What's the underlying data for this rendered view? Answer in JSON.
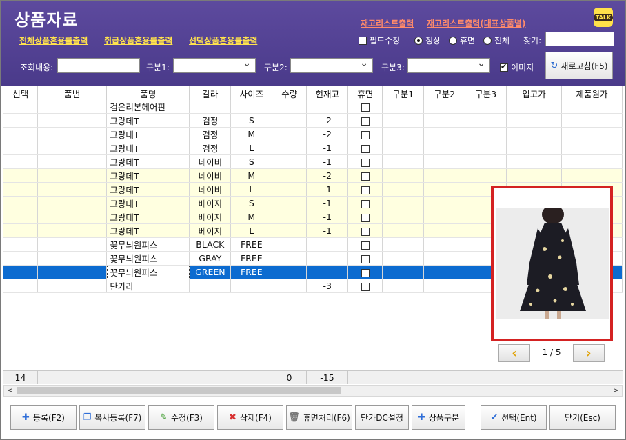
{
  "header": {
    "title": "상품자료",
    "links_top": [
      "재고리스트출력",
      "재고리스트출력(대표상품별)"
    ],
    "links_bottom": [
      "전체상품혼용률출력",
      "취급상품혼용률출력",
      "선택상품혼용률출력"
    ],
    "talk_label": "TALK",
    "field_edit_label": "필드수정",
    "radio_normal": "정상",
    "radio_dormant": "휴면",
    "radio_all": "전체",
    "find_label": "찾기:",
    "find_value": ""
  },
  "filters": {
    "query_label": "조회내용:",
    "cat1_label": "구분1:",
    "cat2_label": "구분2:",
    "cat3_label": "구분3:",
    "image_label": "이미지",
    "refresh_label": "새로고침(F5)"
  },
  "table": {
    "columns": [
      "선택",
      "품번",
      "품명",
      "칼라",
      "사이즈",
      "수량",
      "현재고",
      "휴면",
      "구분1",
      "구분2",
      "구분3",
      "입고가",
      "제품원가"
    ],
    "rows": [
      {
        "name": "검은리본헤어핀",
        "color": "",
        "size": "",
        "qty": "",
        "stock": "",
        "style": "normal"
      },
      {
        "name": "그랑데T",
        "color": "검정",
        "size": "S",
        "qty": "",
        "stock": "-2",
        "style": "normal"
      },
      {
        "name": "그랑데T",
        "color": "검정",
        "size": "M",
        "qty": "",
        "stock": "-2",
        "style": "normal"
      },
      {
        "name": "그랑데T",
        "color": "검정",
        "size": "L",
        "qty": "",
        "stock": "-1",
        "style": "normal"
      },
      {
        "name": "그랑데T",
        "color": "네이비",
        "size": "S",
        "qty": "",
        "stock": "-1",
        "style": "normal"
      },
      {
        "name": "그랑데T",
        "color": "네이비",
        "size": "M",
        "qty": "",
        "stock": "-2",
        "style": "yellow"
      },
      {
        "name": "그랑데T",
        "color": "네이비",
        "size": "L",
        "qty": "",
        "stock": "-1",
        "style": "yellow"
      },
      {
        "name": "그랑데T",
        "color": "베이지",
        "size": "S",
        "qty": "",
        "stock": "-1",
        "style": "yellow"
      },
      {
        "name": "그랑데T",
        "color": "베이지",
        "size": "M",
        "qty": "",
        "stock": "-1",
        "style": "yellow"
      },
      {
        "name": "그랑데T",
        "color": "베이지",
        "size": "L",
        "qty": "",
        "stock": "-1",
        "style": "yellow"
      },
      {
        "name": "꽃무늬원피스",
        "color": "BLACK",
        "size": "FREE",
        "qty": "",
        "stock": "",
        "style": "normal"
      },
      {
        "name": "꽃무늬원피스",
        "color": "GRAY",
        "size": "FREE",
        "qty": "",
        "stock": "",
        "style": "normal"
      },
      {
        "name": "꽃무늬원피스",
        "color": "GREEN",
        "size": "FREE",
        "qty": "",
        "stock": "",
        "style": "sel"
      },
      {
        "name": "단가라",
        "color": "",
        "size": "",
        "qty": "",
        "stock": "-3",
        "style": "normal"
      }
    ]
  },
  "footer": {
    "count": "14",
    "qty_total": "0",
    "stock_total": "-15"
  },
  "preview": {
    "page": "1 / 5",
    "prev_icon": "chevron-left-icon",
    "next_icon": "chevron-right-icon"
  },
  "buttons": {
    "register": "등록(F2)",
    "copy_register": "복사등록(F7)",
    "edit": "수정(F3)",
    "delete": "삭제(F4)",
    "dormant": "휴면처리(F6)",
    "price_dc": "단가DC설정",
    "category": "상품구분",
    "select": "선택(Ent)",
    "close": "닫기(Esc)"
  },
  "colors": {
    "header_bg": "#4f3e90",
    "selected_row": "#0c6bd0",
    "highlight_row": "#ffffe0",
    "image_border": "#d42222"
  }
}
